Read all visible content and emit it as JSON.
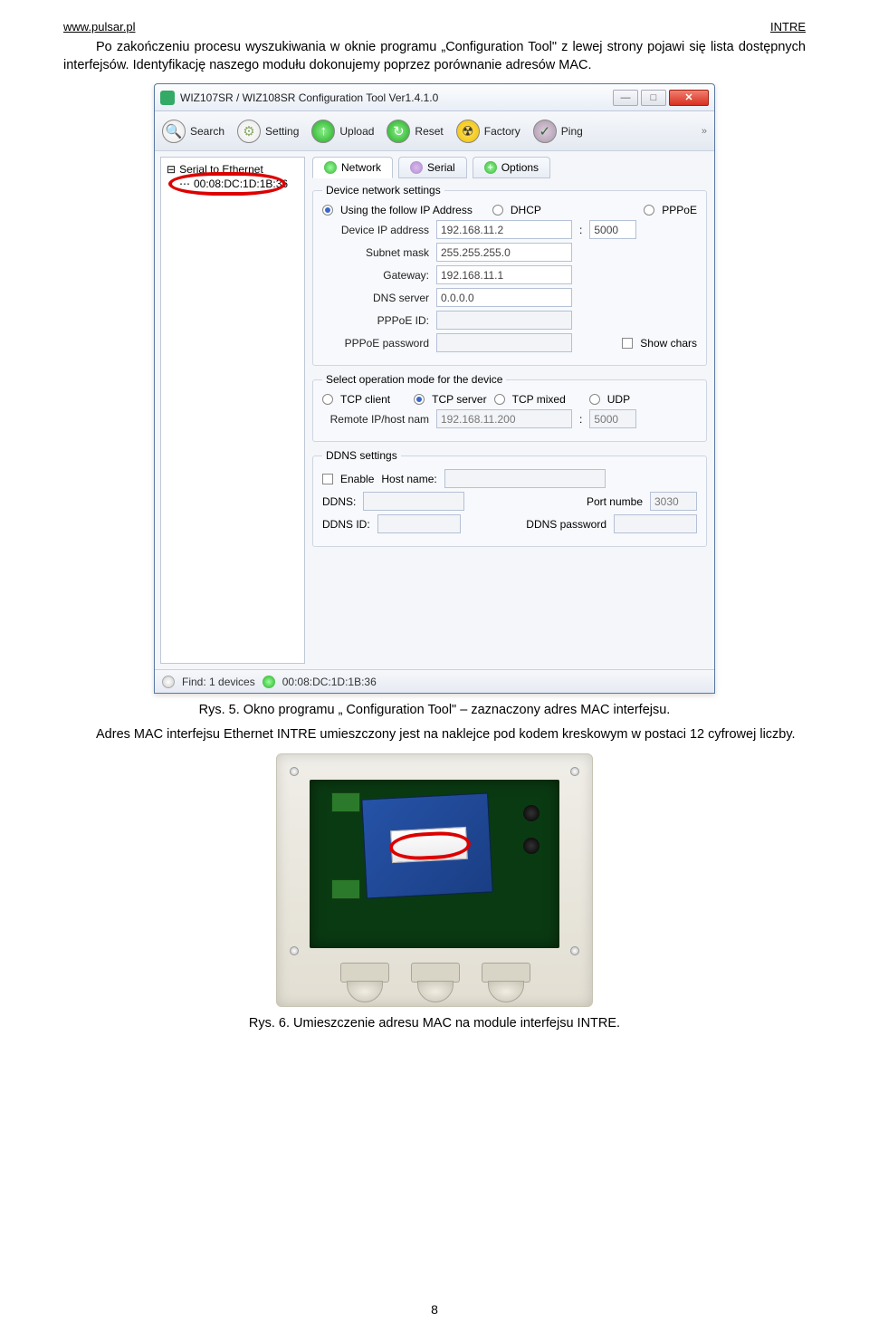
{
  "header": {
    "left": "www.pulsar.pl",
    "right": "INTRE"
  },
  "para1": "Po zakończeniu procesu wyszukiwania w oknie programu „Configuration Tool\" z lewej strony pojawi się lista dostępnych interfejsów. Identyfikację naszego modułu dokonujemy poprzez porównanie adresów MAC.",
  "window": {
    "title": "WIZ107SR / WIZ108SR Configuration Tool Ver1.4.1.0",
    "toolbar": {
      "search": "Search",
      "setting": "Setting",
      "upload": "Upload",
      "reset": "Reset",
      "factory": "Factory",
      "ping": "Ping"
    },
    "tree": {
      "root": "Serial to Ethernet",
      "mac": "00:08:DC:1D:1B:36"
    },
    "tabs": {
      "network": "Network",
      "serial": "Serial",
      "options": "Options"
    },
    "net": {
      "group1": "Device network settings",
      "ipmode_follow": "Using the follow IP Address",
      "ipmode_dhcp": "DHCP",
      "ipmode_pppoe": "PPPoE",
      "ip_label": "Device IP address",
      "ip": "192.168.11.2",
      "port": "5000",
      "mask_label": "Subnet mask",
      "mask": "255.255.255.0",
      "gw_label": "Gateway:",
      "gw": "192.168.11.1",
      "dns_label": "DNS server",
      "dns": "0.0.0.0",
      "pppoeid_label": "PPPoE ID:",
      "pppoeid": "",
      "pppoepw_label": "PPPoE password",
      "pppoepw": "",
      "showchars": "Show chars",
      "group2": "Select operation mode for the device",
      "tcpclient": "TCP client",
      "tcpserver": "TCP server",
      "tcpmixed": "TCP mixed",
      "udp": "UDP",
      "remote_label": "Remote IP/host nam",
      "remote": "192.168.11.200",
      "remote_port": "5000",
      "group3": "DDNS settings",
      "enable": "Enable",
      "host_label": "Host name:",
      "ddns_label": "DDNS:",
      "portnum_label": "Port numbe",
      "portnum": "3030",
      "ddnsid_label": "DDNS ID:",
      "ddnspw_label": "DDNS password"
    },
    "status": {
      "find": "Find: 1 devices",
      "mac": "00:08:DC:1D:1B:36"
    }
  },
  "caption1": "Rys. 5. Okno programu „ Configuration Tool\" – zaznaczony adres MAC interfejsu.",
  "para2": "Adres MAC interfejsu Ethernet INTRE umieszczony jest na naklejce pod kodem kreskowym w postaci 12 cyfrowej liczby.",
  "caption2": "Rys. 6. Umieszczenie adresu MAC na module interfejsu INTRE.",
  "pagenum": "8"
}
